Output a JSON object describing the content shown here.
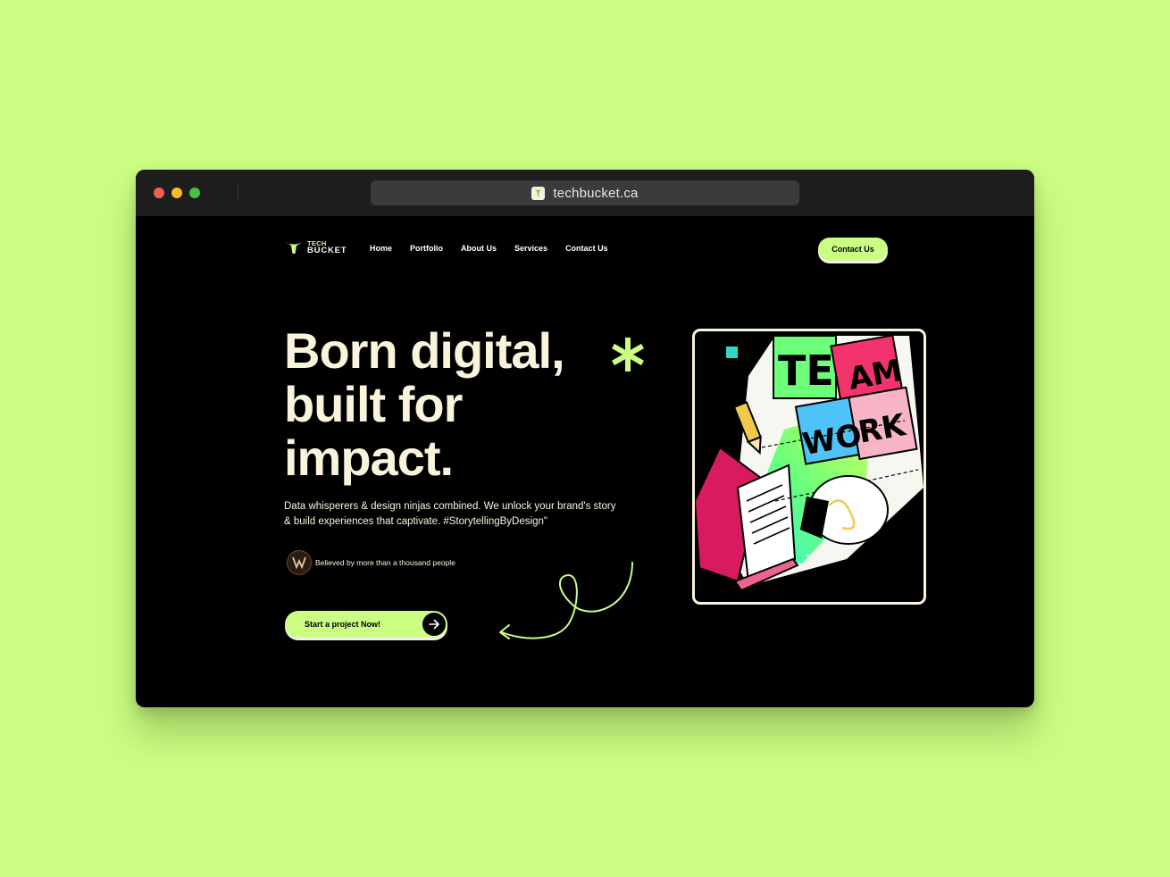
{
  "browser": {
    "url": "techbucket.ca"
  },
  "header": {
    "logo_top": "TECH",
    "logo_bottom": "BUCKET",
    "nav": [
      "Home",
      "Portfolio",
      "About Us",
      "Services",
      "Contact Us"
    ],
    "contact_button": "Contact Us"
  },
  "hero": {
    "headline_line1": "Born digital,",
    "headline_line2": "built for",
    "headline_line3": "impact.",
    "subtext": "Data whisperers & design ninjas combined. We unlock your brand's story & build experiences that captivate. #StorytellingByDesign\"",
    "trust_text": "Believed by more than a thousand people",
    "cta_label": "Start a project Now!"
  },
  "illustration": {
    "word1_a": "TE",
    "word1_b": "AM",
    "word2_a": "WO",
    "word2_b": "RK"
  },
  "colors": {
    "background": "#cbfd83",
    "accent": "#cbfd83",
    "page_bg": "#000000",
    "cream_text": "#fbf4dc",
    "titlebar": "#1d1d1d"
  },
  "icons": [
    "bucket-logo-icon",
    "asterisk-icon",
    "arrow-right-icon",
    "chevron-down-icon",
    "squiggle-arrow-icon"
  ]
}
